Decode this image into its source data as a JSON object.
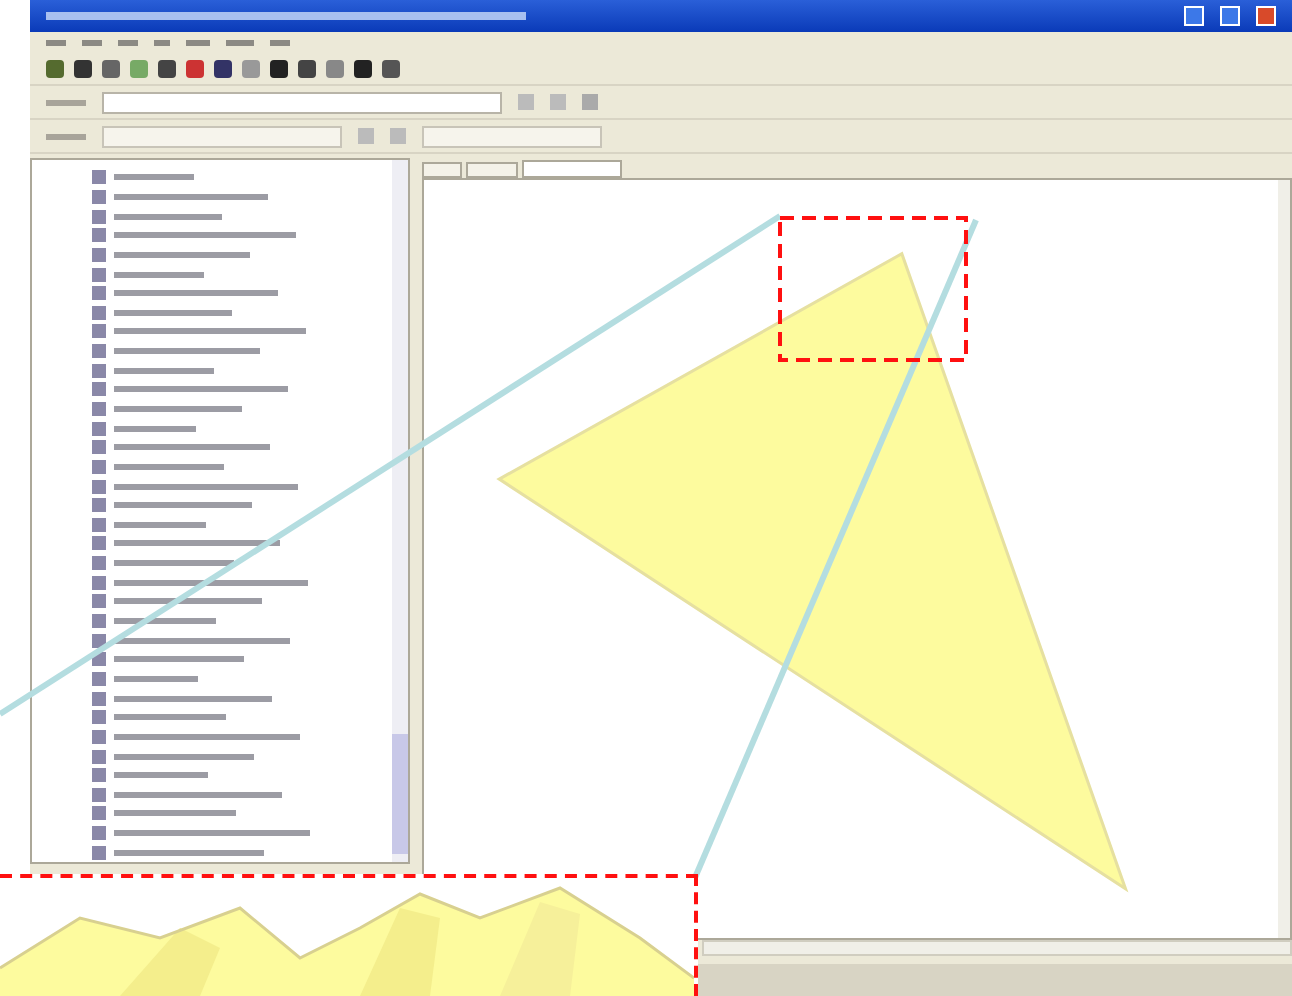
{
  "window": {
    "kind": "app"
  },
  "toolbar_rows": [
    {
      "kind": "icons"
    },
    {
      "kind": "field"
    },
    {
      "kind": "field"
    }
  ],
  "table_of_contents": {
    "items": [
      {
        "kind": "layer"
      },
      {
        "kind": "layer"
      },
      {
        "kind": "layer"
      },
      {
        "kind": "layer"
      },
      {
        "kind": "layer"
      },
      {
        "kind": "layer"
      },
      {
        "kind": "layer"
      },
      {
        "kind": "layer"
      },
      {
        "kind": "layer"
      },
      {
        "kind": "layer"
      },
      {
        "kind": "layer"
      },
      {
        "kind": "layer"
      },
      {
        "kind": "layer"
      },
      {
        "kind": "layer"
      },
      {
        "kind": "layer"
      },
      {
        "kind": "layer"
      },
      {
        "kind": "layer"
      },
      {
        "kind": "layer"
      },
      {
        "kind": "layer"
      },
      {
        "kind": "layer"
      },
      {
        "kind": "layer"
      },
      {
        "kind": "layer"
      },
      {
        "kind": "layer"
      },
      {
        "kind": "layer"
      },
      {
        "kind": "layer"
      },
      {
        "kind": "layer"
      },
      {
        "kind": "layer"
      },
      {
        "kind": "layer"
      },
      {
        "kind": "layer"
      },
      {
        "kind": "layer"
      },
      {
        "kind": "layer"
      },
      {
        "kind": "layer"
      },
      {
        "kind": "layer"
      },
      {
        "kind": "layer"
      },
      {
        "kind": "layer"
      },
      {
        "kind": "layer"
      }
    ]
  },
  "map_tabs": [
    {
      "selected": false
    },
    {
      "selected": false
    },
    {
      "selected": true
    }
  ],
  "map": {
    "features": [
      {
        "kind": "polygon"
      }
    ]
  },
  "callout": {
    "kind": "zoom"
  }
}
